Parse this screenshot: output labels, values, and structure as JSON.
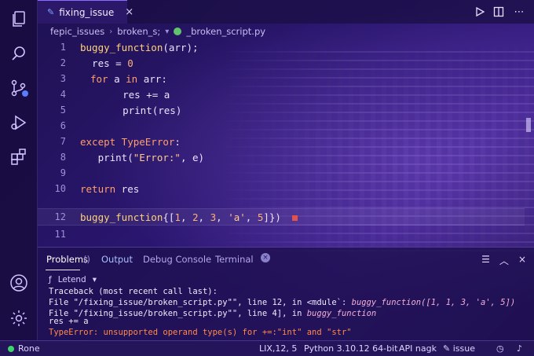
{
  "tab": {
    "title": "fixing_issue",
    "close": "×"
  },
  "breadcrumb": {
    "part1": "fepic_issues",
    "part2": "broken_s;",
    "file": "_broken_script.py"
  },
  "editor": {
    "lines": [
      {
        "num": "1"
      },
      {
        "num": "2"
      },
      {
        "num": "3"
      },
      {
        "num": "4"
      },
      {
        "num": "5"
      },
      {
        "num": "6"
      },
      {
        "num": "7"
      },
      {
        "num": "8"
      },
      {
        "num": "9"
      },
      {
        "num": "10"
      },
      {
        "num": "12"
      },
      {
        "num": "11"
      }
    ],
    "code": {
      "l1_fn": "buggy_function",
      "l1_rest": "(arr);",
      "l2": "  res = ",
      "l2_num": "0",
      "l3_for": "for",
      "l3_a": " a ",
      "l3_in": "in",
      "l3_rest": " arr:",
      "l4": "    res += a",
      "l5": "    print(res)",
      "l7_except": "except",
      "l7_cls": " TypeError",
      "l7_rest": ":",
      "l8_print": "   print(",
      "l8_str": "\"Error:\"",
      "l8_rest": ", e)",
      "l10_return": "return",
      "l10_rest": " res",
      "l12_fn": "buggy_function",
      "l12_open": "{[",
      "l12_n1": "1",
      "l12_c1": ", ",
      "l12_n2": "2",
      "l12_c2": ", ",
      "l12_n3": "3",
      "l12_c3": ", ",
      "l12_s": "'a'",
      "l12_c4": ", ",
      "l12_n5": "5",
      "l12_close": "]})"
    }
  },
  "panel": {
    "tabs": {
      "problems": "Problems",
      "problems_badge": "()",
      "output": "Output",
      "debug": "Debug Console",
      "terminal": "Terminal"
    },
    "filter": {
      "icon": "ƒ",
      "label": "Letend",
      "caret": "▾"
    },
    "output": {
      "l1": "Traceback (most recent call last):",
      "l2a": "File \"/fixing_issue/broken_script.py\"\", line 12, in <mdule`: ",
      "l2b": "buggy_function([1, 1, 3, 'a', 5])",
      "l3a": "File \"/fixing_issue/broken_script.py\"\", line 4], in ",
      "l3b": "buggy_function",
      "l4": "res += a",
      "l5": "TypeError: unsupported operand type(s) for +=:\"int\" and \"str\""
    }
  },
  "status": {
    "branch": "Rone",
    "position": "LIX,12, 5",
    "python": "Python 3.10.12 64-bit",
    "api": "API nagk",
    "issue": "issue"
  },
  "colors": {
    "accent": "#8a6cff",
    "keyword": "#ff9f6b",
    "error": "#ff8a4d",
    "success": "#3fd46a"
  },
  "icons": [
    "explorer-icon",
    "search-icon",
    "source-control-icon",
    "run-debug-icon",
    "extensions-icon",
    "account-icon",
    "settings-gear-icon",
    "run-icon",
    "split-editor-icon",
    "more-icon",
    "close-icon",
    "clear-output-icon",
    "collapse-panel-icon",
    "close-panel-icon",
    "filter-icon",
    "bell-icon",
    "history-icon"
  ]
}
